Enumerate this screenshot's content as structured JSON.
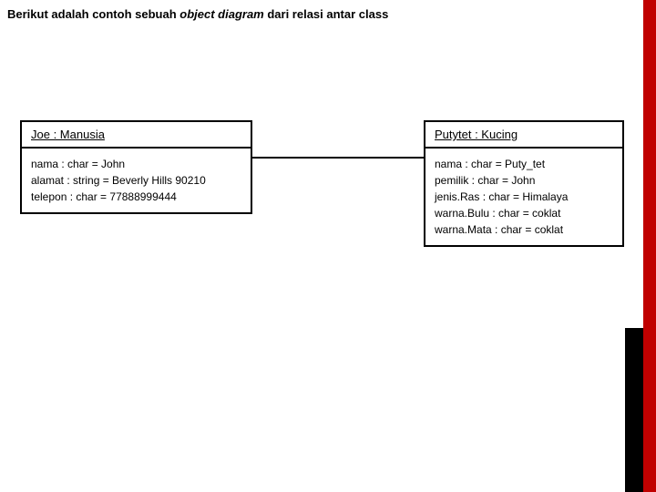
{
  "title": {
    "pre": "Berikut adalah contoh sebuah ",
    "em": "object diagram",
    "post": " dari relasi antar class"
  },
  "left": {
    "header": "Joe : Manusia",
    "attrs": [
      "nama : char = John",
      "alamat : string = Beverly Hills 90210",
      "telepon : char = 77888999444"
    ]
  },
  "right": {
    "header": "Putytet : Kucing",
    "attrs": [
      "nama : char = Puty_tet",
      "pemilik : char = John",
      "jenis.Ras : char = Himalaya",
      "warna.Bulu : char = coklat",
      "warna.Mata : char = coklat"
    ]
  }
}
